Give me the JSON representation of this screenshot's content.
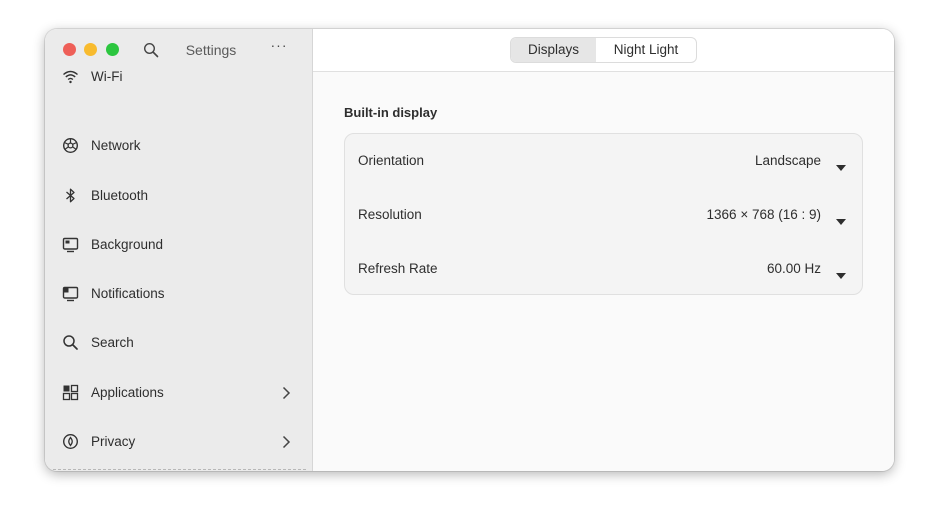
{
  "window": {
    "controls": [
      "close",
      "minimize",
      "maximize"
    ],
    "colors": {
      "close": "#ee5f58",
      "minimize": "#f8bb2e",
      "maximize": "#2cc63f"
    }
  },
  "sidebar": {
    "title": "Settings",
    "menu_glyph": "···",
    "items": [
      {
        "label": "Wi-Fi",
        "icon": "wifi-icon"
      },
      {
        "label": "Network",
        "icon": "network-icon"
      },
      {
        "label": "Bluetooth",
        "icon": "bluetooth-icon"
      },
      {
        "label": "Background",
        "icon": "background-icon"
      },
      {
        "label": "Notifications",
        "icon": "notifications-icon"
      },
      {
        "label": "Search",
        "icon": "search-icon"
      },
      {
        "label": "Applications",
        "icon": "applications-icon",
        "chevron": true
      },
      {
        "label": "Privacy",
        "icon": "privacy-icon",
        "chevron": true
      }
    ]
  },
  "tabs": [
    {
      "label": "Displays",
      "active": true
    },
    {
      "label": "Night Light",
      "active": false
    }
  ],
  "display": {
    "section_title": "Built-in display",
    "rows": [
      {
        "label": "Orientation",
        "value": "Landscape"
      },
      {
        "label": "Resolution",
        "value": "1366 × 768 (16 : 9)"
      },
      {
        "label": "Refresh Rate",
        "value": "60.00 Hz"
      }
    ]
  }
}
